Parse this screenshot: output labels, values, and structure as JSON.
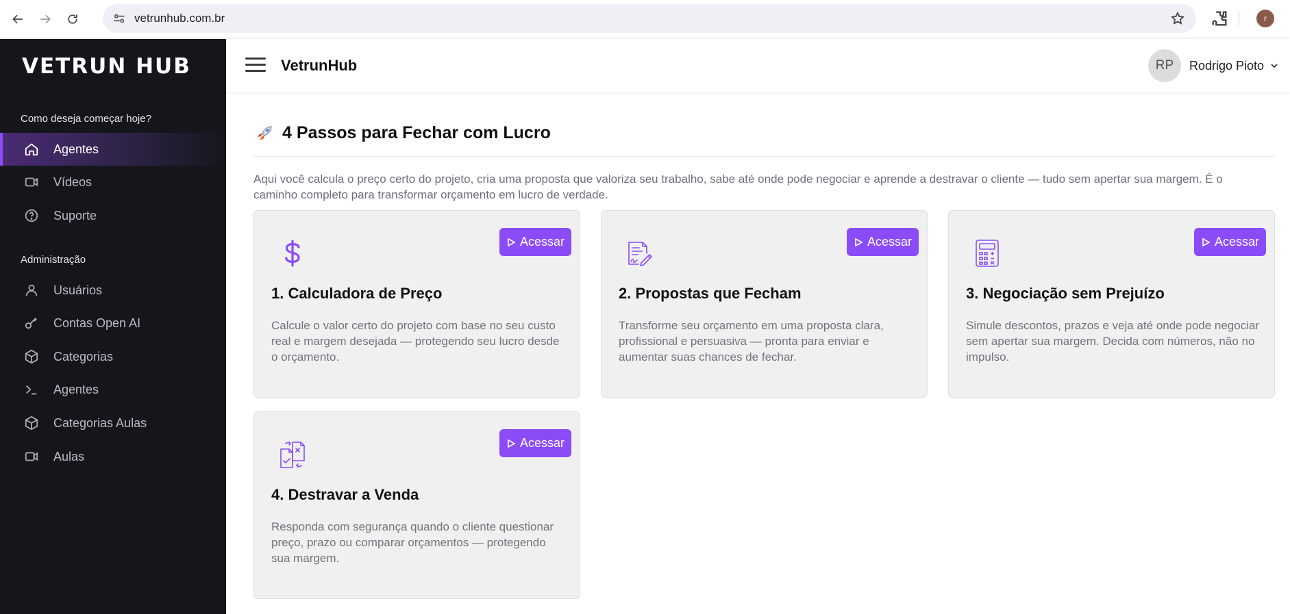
{
  "browser": {
    "url": "vetrunhub.com.br",
    "profile_initial": "r"
  },
  "sidebar": {
    "logo": "VETRUN HUB",
    "section_start": "Como deseja começar hoje?",
    "items_start": [
      {
        "label": "Agentes",
        "icon": "home-icon"
      },
      {
        "label": "Vídeos",
        "icon": "video-icon"
      },
      {
        "label": "Suporte",
        "icon": "help-circle-icon"
      }
    ],
    "section_admin": "Administração",
    "items_admin": [
      {
        "label": "Usuários",
        "icon": "user-icon"
      },
      {
        "label": "Contas Open AI",
        "icon": "key-icon"
      },
      {
        "label": "Categorias",
        "icon": "cube-icon"
      },
      {
        "label": "Agentes",
        "icon": "terminal-icon"
      },
      {
        "label": "Categorias Aulas",
        "icon": "cube-icon"
      },
      {
        "label": "Aulas",
        "icon": "video-icon"
      }
    ]
  },
  "header": {
    "title": "VetrunHub",
    "user_initials": "RP",
    "user_name": "Rodrigo Pioto"
  },
  "main": {
    "title": "4 Passos para Fechar com Lucro",
    "intro": "Aqui você calcula o preço certo do projeto, cria uma proposta que valoriza seu trabalho, sabe até onde pode negociar e aprende a destravar o cliente — tudo sem apertar sua margem. É o caminho completo para transformar orçamento em lucro de verdade.",
    "cards": [
      {
        "title": "1. Calculadora de Preço",
        "desc": "Calcule o valor certo do projeto com base no seu custo real e margem desejada — protegendo seu lucro desde o orçamento.",
        "button": "Acessar",
        "icon": "dollar-icon"
      },
      {
        "title": "2. Propostas que Fecham",
        "desc": "Transforme seu orçamento em uma proposta clara, profissional e persuasiva — pronta para enviar e aumentar suas chances de fechar.",
        "button": "Acessar",
        "icon": "contract-signature-icon"
      },
      {
        "title": "3. Negociação sem Prejuízo",
        "desc": "Simule descontos, prazos e veja até onde pode negociar sem apertar sua margem. Decida com números, não no impulso.",
        "button": "Acessar",
        "icon": "calculator-icon"
      },
      {
        "title": "4. Destravar a Venda",
        "desc": "Responda com segurança quando o cliente questionar preço, prazo ou comparar orçamentos — protegendo sua margem.",
        "button": "Acessar",
        "icon": "document-exchange-icon"
      }
    ]
  },
  "colors": {
    "accent": "#8b4cf7",
    "sidebar_bg": "#15161c",
    "card_bg": "#f0f0f0"
  }
}
